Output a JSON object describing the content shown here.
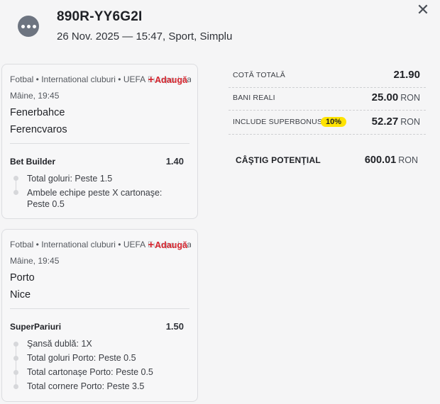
{
  "header": {
    "ticket_id": "890R-YY6G2I",
    "meta": "26 Nov. 2025 — 15:47, Sport, Simplu",
    "menu_icon": "more-dots-icon",
    "close_icon": "close-icon",
    "close_glyph": "✕"
  },
  "bets": [
    {
      "breadcrumb": "Fotbal • International cluburi • UEFA Europa League",
      "add_label": "Adaugă",
      "add_plus": "+",
      "time": "Mâine, 19:45",
      "home": "Fenerbahce",
      "away": "Ferencvaros",
      "market": "Bet Builder",
      "odds": "1.40",
      "selections": [
        "Total goluri: Peste 1.5",
        "Ambele echipe peste X cartonaşe: Peste 0.5"
      ]
    },
    {
      "breadcrumb": "Fotbal • International cluburi • UEFA Europa League",
      "add_label": "Adaugă",
      "add_plus": "+",
      "time": "Mâine, 19:45",
      "home": "Porto",
      "away": "Nice",
      "market": "SuperPariuri",
      "odds": "1.50",
      "selections": [
        "Şansă dublă: 1X",
        "Total goluri Porto: Peste 0.5",
        "Total cartonaşe Porto: Peste 0.5",
        "Total cornere Porto: Peste 3.5"
      ]
    }
  ],
  "summary": {
    "total_odds_label": "COTĂ TOTALĂ",
    "total_odds": "21.90",
    "stake_label": "BANI REALI",
    "stake": "25.00",
    "stake_currency": "RON",
    "bonus_label": "INCLUDE SUPERBONUS",
    "bonus_badge": "10%",
    "bonus_value": "52.27",
    "bonus_currency": "RON",
    "win_label": "CÂŞTIG POTENŢIAL",
    "win_value": "600.01",
    "win_currency": "RON"
  },
  "colors": {
    "accent_red": "#d7262f",
    "badge_yellow": "#ffe300",
    "menu_gray": "#6d7480"
  }
}
